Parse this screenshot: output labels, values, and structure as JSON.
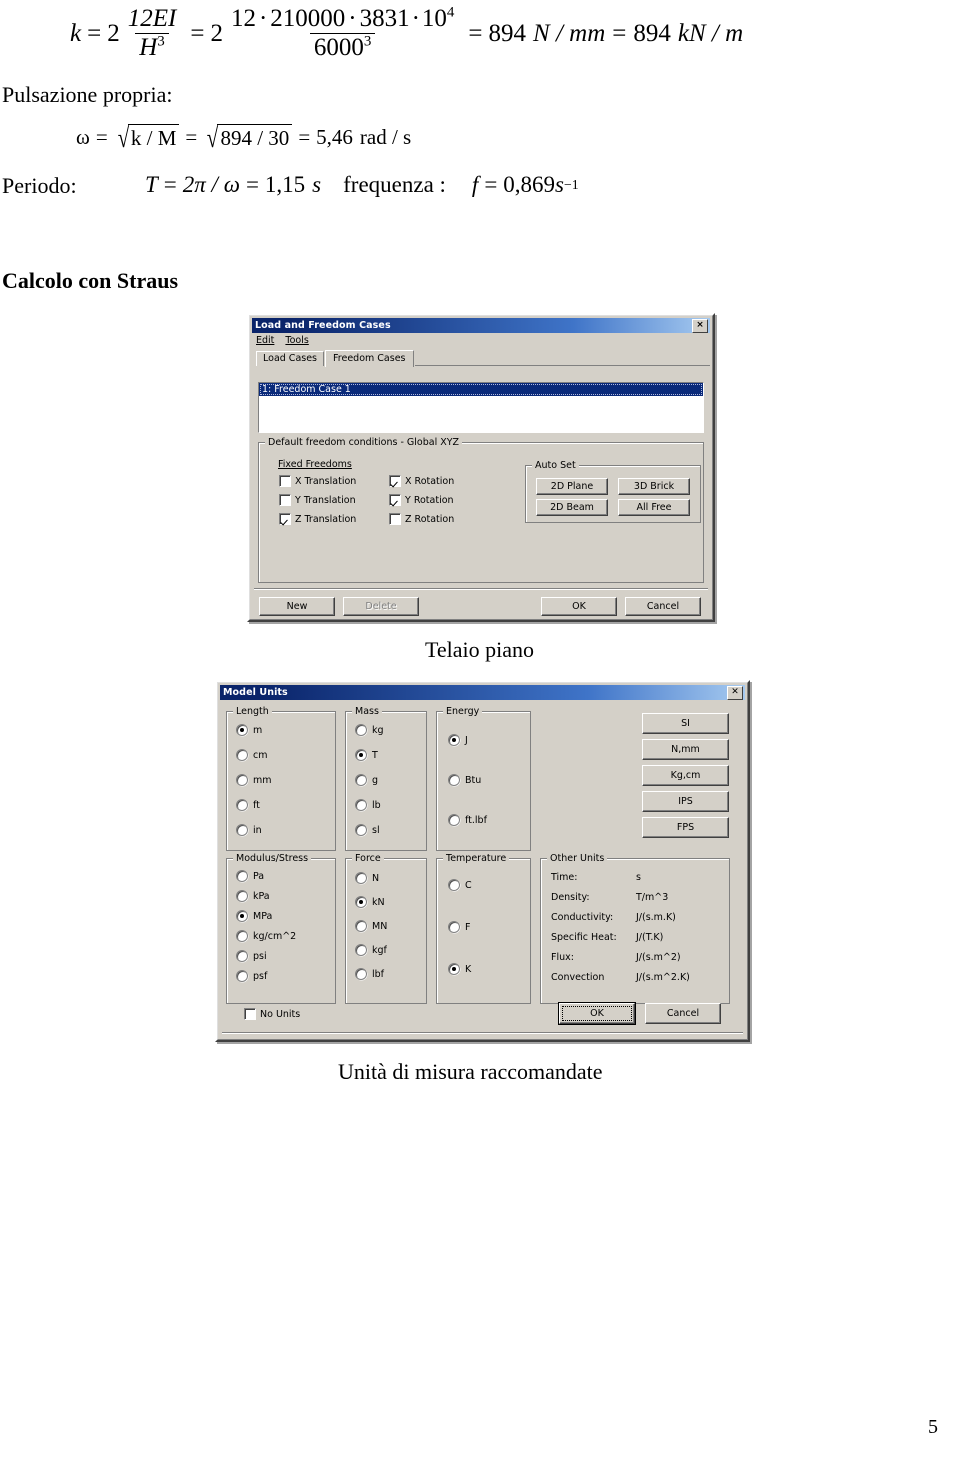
{
  "document": {
    "page_number": "5",
    "equations": {
      "stiffness": {
        "lhs_var": "k",
        "eq1": "=",
        "coef1": "2",
        "frac1_num": "12EI",
        "frac1_den_base": "H",
        "frac1_den_exp": "3",
        "eq2": "=",
        "coef2": "2",
        "frac2_num_a": "12",
        "frac2_dot1": "·",
        "frac2_num_b": "210000",
        "frac2_dot2": "·",
        "frac2_num_c": "3831",
        "frac2_dot3": "·",
        "frac2_num_d": "10",
        "frac2_num_exp": "4",
        "frac2_den_base": "6000",
        "frac2_den_exp": "3",
        "eq3": "=",
        "result1": "894",
        "unit1": "N / mm",
        "eq4": "=",
        "result2": "894",
        "unit2": "kN / m"
      },
      "pulsazione_label": "Pulsazione propria:",
      "omega": {
        "symbol": "ω",
        "eq1": "=",
        "rad1": "k / M",
        "eq2": "=",
        "rad2": "894 / 30",
        "eq3": "=",
        "value": "5,46",
        "unit": "rad / s"
      },
      "periodo_label": "Periodo:",
      "periodo": {
        "symbol": "T",
        "eq1": "=",
        "expr": "2π / ω",
        "eq2": "=",
        "value": "1,15",
        "unit": "s"
      },
      "frequenza_label": "frequenza :",
      "frequenza": {
        "symbol": "f",
        "eq": "=",
        "value": "0,869",
        "unit_base": "s",
        "unit_exp": "−1"
      }
    },
    "section_heading": "Calcolo con Straus",
    "caption_frame": "Telaio piano",
    "caption_units": "Unità di misura raccomandate"
  },
  "dialog_load_freedom": {
    "title": "Load and Freedom Cases",
    "close_icon": "×",
    "menu": [
      {
        "label": "Edit",
        "mnemonic": "E"
      },
      {
        "label": "Tools",
        "mnemonic": "T"
      }
    ],
    "tabs": [
      {
        "label": "Load Cases",
        "active": false
      },
      {
        "label": "Freedom Cases",
        "active": true
      }
    ],
    "list_selected_item": "1: Freedom Case 1",
    "group_default": "Default freedom conditions - Global XYZ",
    "group_fixed_freedoms": "Fixed Freedoms",
    "checkboxes": [
      {
        "label": "X Translation",
        "checked": false
      },
      {
        "label": "Y Translation",
        "checked": false
      },
      {
        "label": "Z Translation",
        "checked": true
      },
      {
        "label": "X Rotation",
        "checked": true
      },
      {
        "label": "Y Rotation",
        "checked": true
      },
      {
        "label": "Z Rotation",
        "checked": false
      }
    ],
    "group_auto_set": "Auto Set",
    "auto_set_buttons": [
      {
        "label": "2D Plane"
      },
      {
        "label": "3D Brick"
      },
      {
        "label": "2D Beam"
      },
      {
        "label": "All Free"
      }
    ],
    "footer_buttons": [
      {
        "label": "New",
        "disabled": false
      },
      {
        "label": "Delete",
        "disabled": true
      },
      {
        "label": "OK",
        "disabled": false
      },
      {
        "label": "Cancel",
        "disabled": false
      }
    ]
  },
  "dialog_model_units": {
    "title": "Model Units",
    "close_icon": "✕",
    "groups": {
      "length": {
        "title": "Length",
        "options": [
          {
            "label": "m",
            "selected": true
          },
          {
            "label": "cm",
            "selected": false
          },
          {
            "label": "mm",
            "selected": false
          },
          {
            "label": "ft",
            "selected": false
          },
          {
            "label": "in",
            "selected": false
          }
        ]
      },
      "mass": {
        "title": "Mass",
        "options": [
          {
            "label": "kg",
            "selected": false
          },
          {
            "label": "T",
            "selected": true
          },
          {
            "label": "g",
            "selected": false
          },
          {
            "label": "lb",
            "selected": false
          },
          {
            "label": "sl",
            "selected": false
          }
        ]
      },
      "energy": {
        "title": "Energy",
        "options": [
          {
            "label": "J",
            "selected": true
          },
          {
            "label": "Btu",
            "selected": false
          },
          {
            "label": "ft.lbf",
            "selected": false
          }
        ]
      },
      "modulus_stress": {
        "title": "Modulus/Stress",
        "options": [
          {
            "label": "Pa",
            "selected": false
          },
          {
            "label": "kPa",
            "selected": false
          },
          {
            "label": "MPa",
            "selected": true
          },
          {
            "label": "kg/cm^2",
            "selected": false
          },
          {
            "label": "psi",
            "selected": false
          },
          {
            "label": "psf",
            "selected": false
          }
        ]
      },
      "force": {
        "title": "Force",
        "options": [
          {
            "label": "N",
            "selected": false
          },
          {
            "label": "kN",
            "selected": true
          },
          {
            "label": "MN",
            "selected": false
          },
          {
            "label": "kgf",
            "selected": false
          },
          {
            "label": "lbf",
            "selected": false
          }
        ]
      },
      "temperature": {
        "title": "Temperature",
        "options": [
          {
            "label": "C",
            "selected": false
          },
          {
            "label": "F",
            "selected": false
          },
          {
            "label": "K",
            "selected": true
          }
        ]
      },
      "other_units": {
        "title": "Other Units",
        "rows": [
          {
            "name": "Time:",
            "value": "s"
          },
          {
            "name": "Density:",
            "value": "T/m^3"
          },
          {
            "name": "Conductivity:",
            "value": "J/(s.m.K)"
          },
          {
            "name": "Specific Heat:",
            "value": "J/(T.K)"
          },
          {
            "name": "Flux:",
            "value": "J/(s.m^2)"
          },
          {
            "name": "Convection",
            "value": "J/(s.m^2.K)"
          }
        ]
      }
    },
    "preset_buttons": [
      {
        "label": "SI"
      },
      {
        "label": "N,mm"
      },
      {
        "label": "Kg,cm"
      },
      {
        "label": "IPS"
      },
      {
        "label": "FPS"
      }
    ],
    "no_units": {
      "label": "No Units",
      "checked": false
    },
    "footer_buttons": [
      {
        "label": "OK",
        "default": true
      },
      {
        "label": "Cancel",
        "default": false
      }
    ]
  },
  "colors": {
    "dialog_face": "#d4d0c8",
    "titlebar_start": "#0a246a",
    "titlebar_end": "#a6caf0",
    "selection": "#0a2a7a",
    "page_background": "#ffffff"
  }
}
